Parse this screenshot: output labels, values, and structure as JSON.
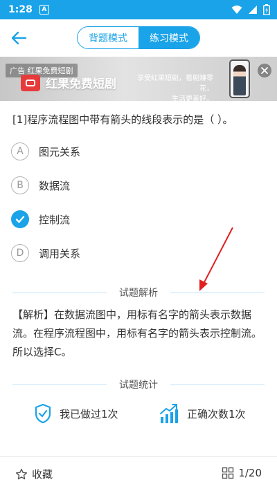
{
  "status_bar": {
    "time": "1:28",
    "notif_letter": "A"
  },
  "header": {
    "tabs": [
      "背题模式",
      "练习模式"
    ],
    "active_tab": 1
  },
  "ad": {
    "tag": "广告  红果免费短剧",
    "title": "红果免费短剧",
    "slogan_line1": "享受红果短剧，看剧赚零花，",
    "slogan_line2": "生活更美好。"
  },
  "question": {
    "text": "[1]程序流程图中带有箭头的线段表示的是（ ）。",
    "options": [
      {
        "letter": "A",
        "text": "图元关系",
        "checked": false
      },
      {
        "letter": "B",
        "text": "数据流",
        "checked": false
      },
      {
        "letter": "C",
        "text": "控制流",
        "checked": true
      },
      {
        "letter": "D",
        "text": "调用关系",
        "checked": false
      }
    ]
  },
  "analysis": {
    "title": "试题解析",
    "text": "【解析】在数据流图中，用标有名字的箭头表示数据流。在程序流程图中，用标有名字的箭头表示控制流。所以选择C。"
  },
  "stats": {
    "title": "试题统计",
    "done": "我已做过1次",
    "correct": "正确次数1次"
  },
  "footer": {
    "favorite": "收藏",
    "page": "1/20"
  },
  "colors": {
    "accent": "#1aa3e8",
    "annotation": "#e02020"
  }
}
